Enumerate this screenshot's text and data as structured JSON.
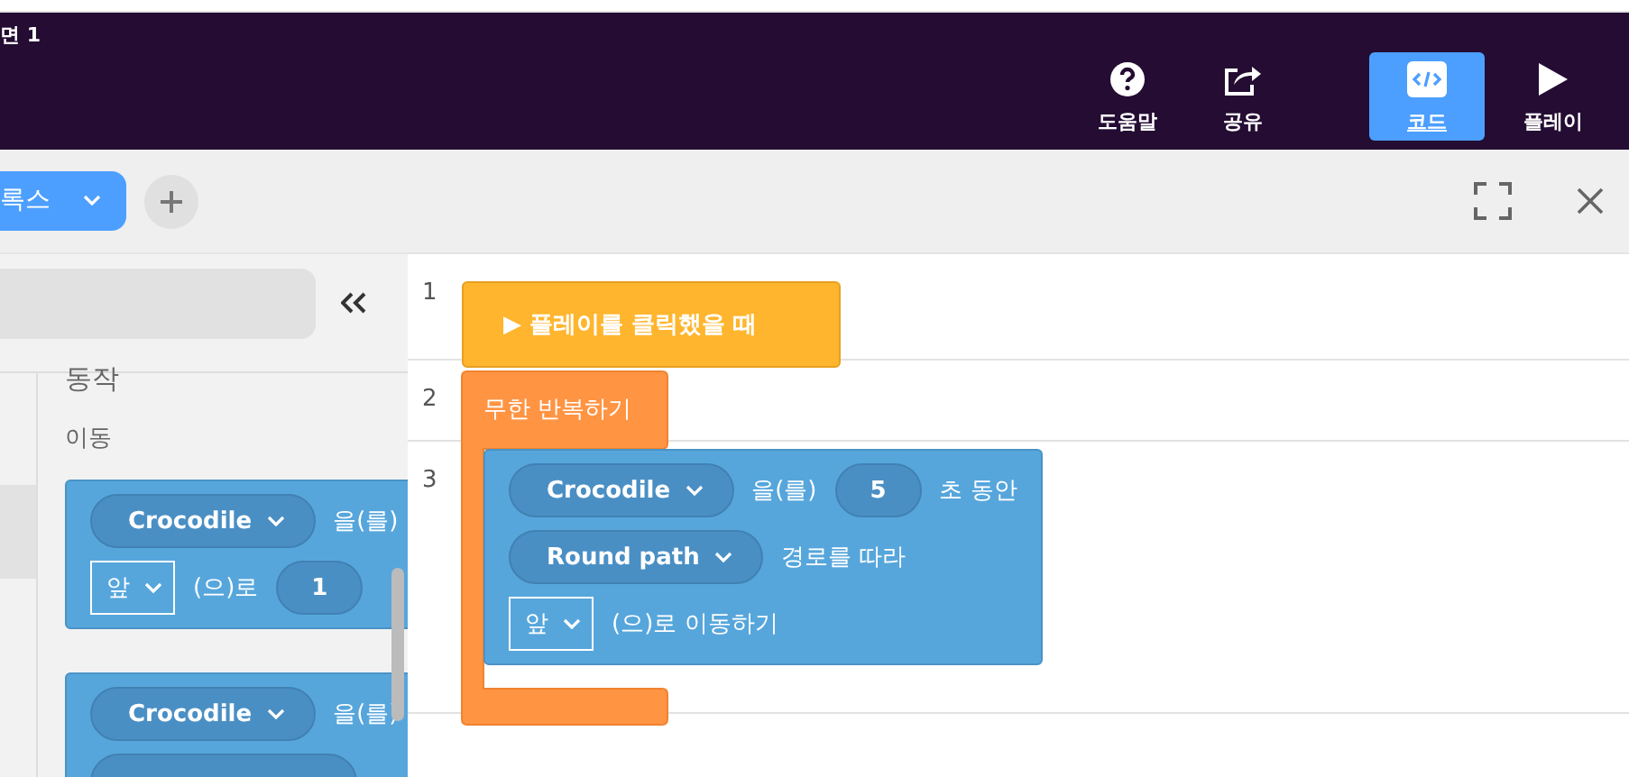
{
  "header": {
    "title": "면 1",
    "actions": [
      {
        "kind": "help",
        "label": "도움말",
        "selected": false
      },
      {
        "kind": "share",
        "label": "공유",
        "selected": false
      },
      {
        "kind": "code",
        "label": "코드",
        "selected": true
      },
      {
        "kind": "play",
        "label": "플레이",
        "selected": false
      }
    ]
  },
  "toolbar": {
    "sprite_tab": {
      "label": "록스"
    }
  },
  "palette": {
    "category": "동작",
    "subcategory": "이동",
    "blocks": [
      {
        "lines": [
          {
            "parts": [
              {
                "kind": "pill",
                "text": "Crocodile"
              },
              {
                "kind": "text",
                "text": "을(를)"
              }
            ]
          },
          {
            "parts": [
              {
                "kind": "select",
                "text": "앞"
              },
              {
                "kind": "text",
                "text": "(으)로"
              },
              {
                "kind": "number",
                "text": "1"
              }
            ]
          }
        ]
      },
      {
        "lines": [
          {
            "parts": [
              {
                "kind": "pill",
                "text": "Crocodile"
              },
              {
                "kind": "text",
                "text": "을(를)"
              }
            ]
          },
          {
            "parts": [
              {
                "kind": "slot"
              }
            ]
          }
        ]
      }
    ]
  },
  "code": {
    "lines": [
      "1",
      "2",
      "3"
    ],
    "event": {
      "icon": "▶",
      "text": "플레이를 클릭했을 때"
    },
    "loop": {
      "text": "무한 반복하기"
    },
    "block": {
      "rows": [
        [
          {
            "kind": "pill",
            "text": "Crocodile"
          },
          {
            "kind": "text",
            "text": "을(를)"
          },
          {
            "kind": "number",
            "text": "5"
          },
          {
            "kind": "text",
            "text": "초 동안"
          }
        ],
        [
          {
            "kind": "pill",
            "text": "Round path"
          },
          {
            "kind": "text",
            "text": "경로를 따라"
          }
        ],
        [
          {
            "kind": "select",
            "text": "앞"
          },
          {
            "kind": "text",
            "text": "(으)로 이동하기"
          }
        ]
      ]
    }
  }
}
